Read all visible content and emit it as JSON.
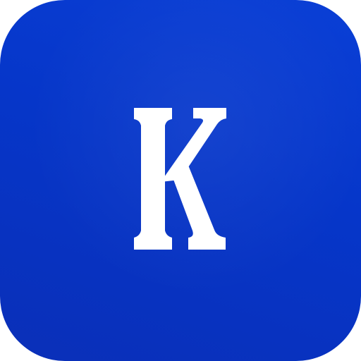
{
  "app_icon": {
    "background_color": "#0636c9",
    "glyph_color": "#ffffff",
    "logo_letter": "K",
    "icon": "letter-k-logo-icon"
  }
}
